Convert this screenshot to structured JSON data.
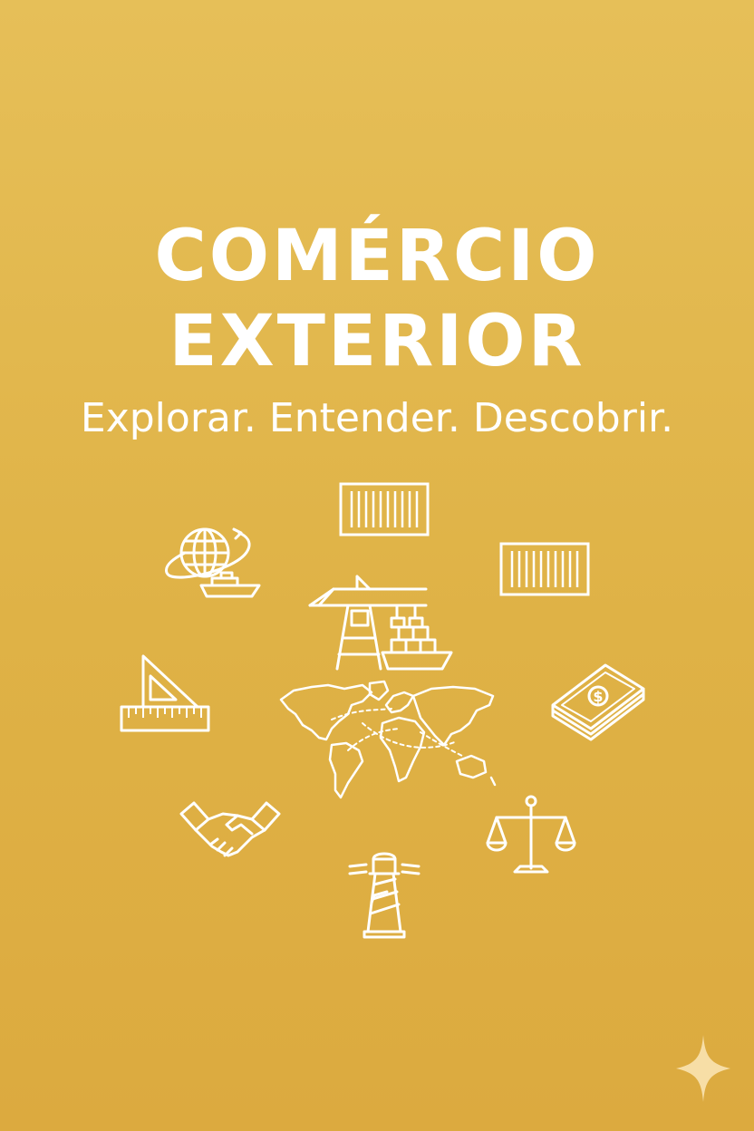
{
  "cover": {
    "title_line1": "COMÉRCIO",
    "title_line2": "EXTERIOR",
    "tagline": "Explorar. Entender. Descobrir."
  },
  "icons": [
    "globe-orbit-icon",
    "shipping-container-icon",
    "port-crane-icon",
    "set-square-ruler-icon",
    "world-map-icon",
    "money-stack-icon",
    "handshake-icon",
    "scales-of-justice-icon",
    "lighthouse-icon",
    "sparkle-icon"
  ],
  "colors": {
    "background_top": "#e6bf58",
    "background_bottom": "#dcaa3f",
    "foreground": "#ffffff"
  }
}
